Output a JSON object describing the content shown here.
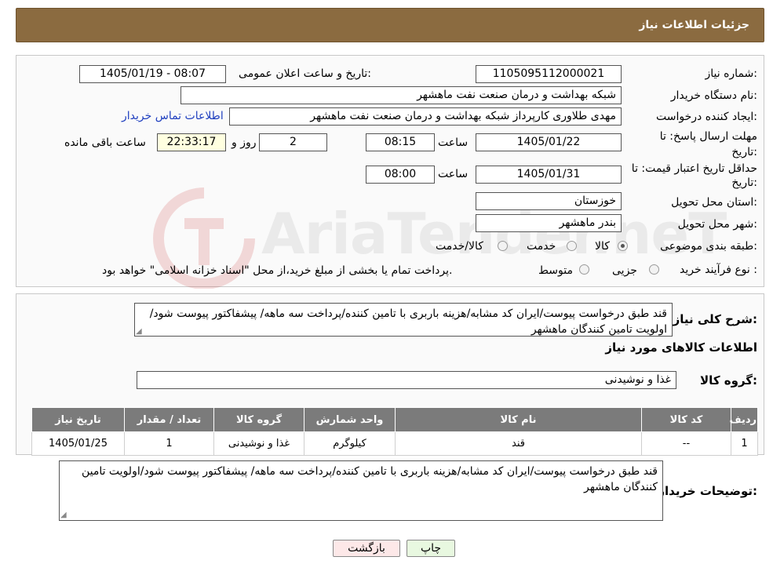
{
  "header": {
    "title": "جزئیات اطلاعات نیاز"
  },
  "form": {
    "need_number": {
      "label": "شماره نیاز:",
      "value": "1105095112000021"
    },
    "announce_datetime": {
      "label": "تاریخ و ساعت اعلان عمومی:",
      "value": "1405/01/19 - 08:07"
    },
    "buyer_org": {
      "label": "نام دستگاه خریدار:",
      "value": "شبکه بهداشت و درمان صنعت نفت ماهشهر"
    },
    "requester": {
      "label": "ایجاد کننده درخواست:",
      "value": "مهدی طلاوری کارپرداز شبکه بهداشت و درمان صنعت نفت ماهشهر",
      "contact_link": "اطلاعات تماس خریدار"
    },
    "reply_deadline": {
      "label_line1": "مهلت ارسال پاسخ: تا",
      "label_line2": "تاریخ:",
      "date": "1405/01/22",
      "time_label": "ساعت",
      "time": "08:15",
      "days": "2",
      "days_label": "روز و",
      "remaining": "22:33:17",
      "remaining_label": "ساعت باقی مانده"
    },
    "price_validity": {
      "label_line1": "حداقل تاریخ اعتبار قیمت: تا",
      "label_line2": "تاریخ:",
      "date": "1405/01/31",
      "time_label": "ساعت",
      "time": "08:00"
    },
    "province": {
      "label": "استان محل تحویل:",
      "value": "خوزستان"
    },
    "city": {
      "label": "شهر محل تحویل:",
      "value": "بندر ماهشهر"
    },
    "category": {
      "label": "طبقه بندی موضوعی:",
      "options": [
        "کالا",
        "خدمت",
        "کالا/خدمت"
      ],
      "selected": "کالا"
    },
    "purchase_type": {
      "label": "نوع فرآیند خرید :",
      "options": [
        "جزیی",
        "متوسط"
      ],
      "note": "پرداخت تمام یا بخشی از مبلغ خرید،از محل \"اسناد خزانه اسلامی\" خواهد بود."
    }
  },
  "description": {
    "label": "شرح کلی نیاز:",
    "text": "قند طبق درخواست پیوست/ایران کد مشابه/هزینه باربری با تامین کننده/پرداخت سه ماهه/ پیشفاکتور پیوست شود/اولویت تامین کنندگان ماهشهر"
  },
  "goods_section": {
    "title": "اطلاعات کالاهای مورد نیاز"
  },
  "goods_group": {
    "label": "گروه کالا:",
    "value": "غذا و نوشیدنی"
  },
  "table": {
    "headers": [
      "ردیف",
      "کد کالا",
      "نام کالا",
      "واحد شمارش",
      "گروه کالا",
      "تعداد / مقدار",
      "تاریخ نیاز"
    ],
    "rows": [
      [
        "1",
        "--",
        "قند",
        "کیلوگرم",
        "غذا و نوشیدنی",
        "1",
        "1405/01/25"
      ]
    ]
  },
  "buyer_notes": {
    "label": "توضیحات خریدار:",
    "text": "قند طبق درخواست پیوست/ایران کد مشابه/هزینه باربری با تامین کننده/پرداخت سه ماهه/ پیشفاکتور پیوست شود/اولویت تامین کنندگان ماهشهر"
  },
  "buttons": {
    "print": "چاپ",
    "back": "بازگشت"
  },
  "watermark": {
    "text": "AriaTender.neT"
  },
  "colors": {
    "header_bg": "#8b6b40",
    "table_header_bg": "#7b7b7b",
    "back_btn_bg": "#fde8e8",
    "print_btn_bg": "#e8f8e0"
  }
}
